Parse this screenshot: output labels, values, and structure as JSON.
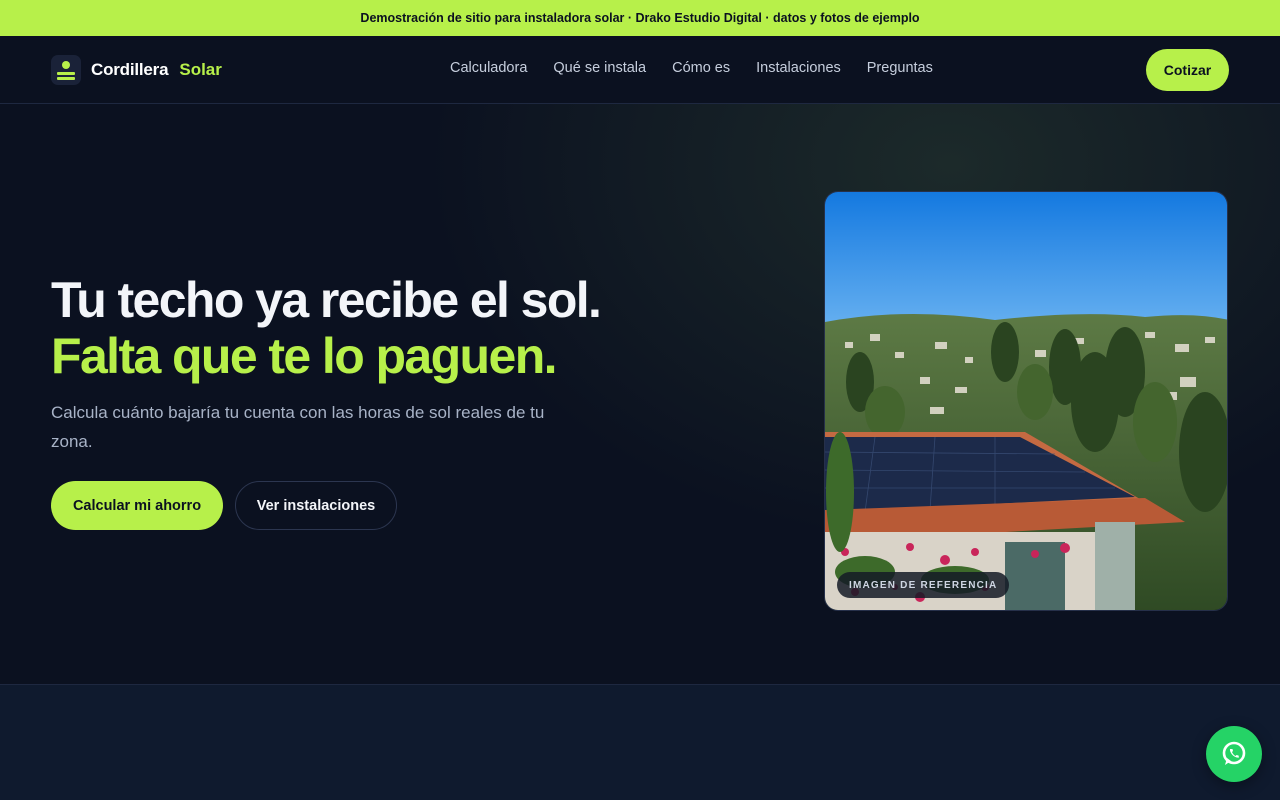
{
  "banner": {
    "text": "Demostración de sitio para instaladora solar · Drako Estudio Digital · datos y fotos de ejemplo"
  },
  "brand": {
    "name": "Cordillera",
    "accent": "Solar",
    "logo_icon": "sun-panel-icon"
  },
  "nav": {
    "links": [
      "Calculadora",
      "Qué se instala",
      "Cómo es",
      "Instalaciones",
      "Preguntas"
    ],
    "cta": "Cotizar"
  },
  "hero": {
    "title_line1": "Tu techo ya recibe el sol.",
    "title_line2": "Falta que te lo paguen.",
    "subtitle": "Calcula cuánto bajaría tu cuenta con las horas de sol reales de tu zona.",
    "primary_button": "Calcular mi ahorro",
    "secondary_button": "Ver instalaciones",
    "image_badge": "IMAGEN DE REFERENCIA"
  },
  "floating": {
    "whatsapp_icon": "whatsapp-icon"
  },
  "colors": {
    "accent": "#b7f04a",
    "background": "#0b1120",
    "whatsapp": "#25d366"
  }
}
